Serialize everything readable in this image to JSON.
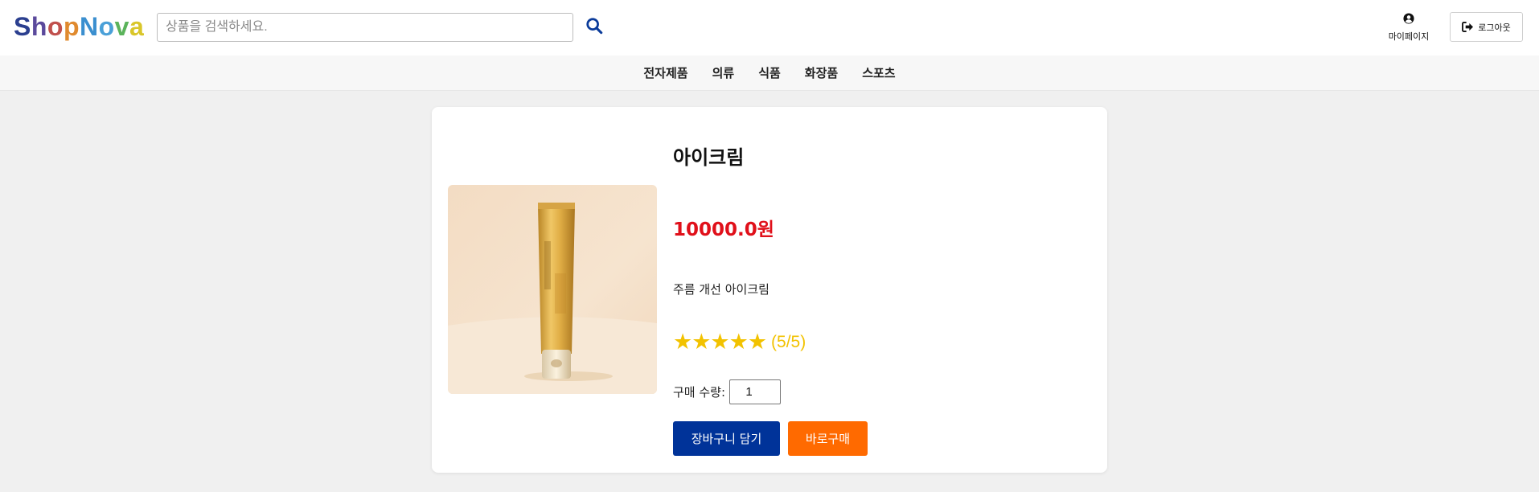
{
  "header": {
    "logo": {
      "letters": [
        {
          "ch": "S",
          "color": "#2b3f8f"
        },
        {
          "ch": "h",
          "color": "#5b4a9c"
        },
        {
          "ch": "o",
          "color": "#c0504d"
        },
        {
          "ch": "p",
          "color": "#e08a2e"
        },
        {
          "ch": "N",
          "color": "#3b8fcf"
        },
        {
          "ch": "o",
          "color": "#4aa0d8"
        },
        {
          "ch": "v",
          "color": "#5bb35b"
        },
        {
          "ch": "a",
          "color": "#d9c62a"
        }
      ]
    },
    "search": {
      "placeholder": "상품을 검색하세요.",
      "value": "",
      "icon": "search-icon"
    },
    "mypage_label": "마이페이지",
    "logout_label": "로그아웃"
  },
  "categories": [
    "전자제품",
    "의류",
    "식품",
    "화장품",
    "스포츠"
  ],
  "product": {
    "title": "아이크림",
    "price": "10000.0원",
    "description": "주름 개선 아이크림",
    "stars": "★★★★★",
    "rating_text": "(5/5)",
    "rating_value": 5,
    "rating_max": 5,
    "quantity_label": "구매 수량:",
    "quantity_value": "1",
    "add_to_cart_label": "장바구니 담기",
    "buy_now_label": "바로구매"
  },
  "colors": {
    "brand_blue": "#003399",
    "buy_orange": "#ff6a00",
    "price_red": "#e0101a",
    "star_yellow": "#f2c200"
  }
}
